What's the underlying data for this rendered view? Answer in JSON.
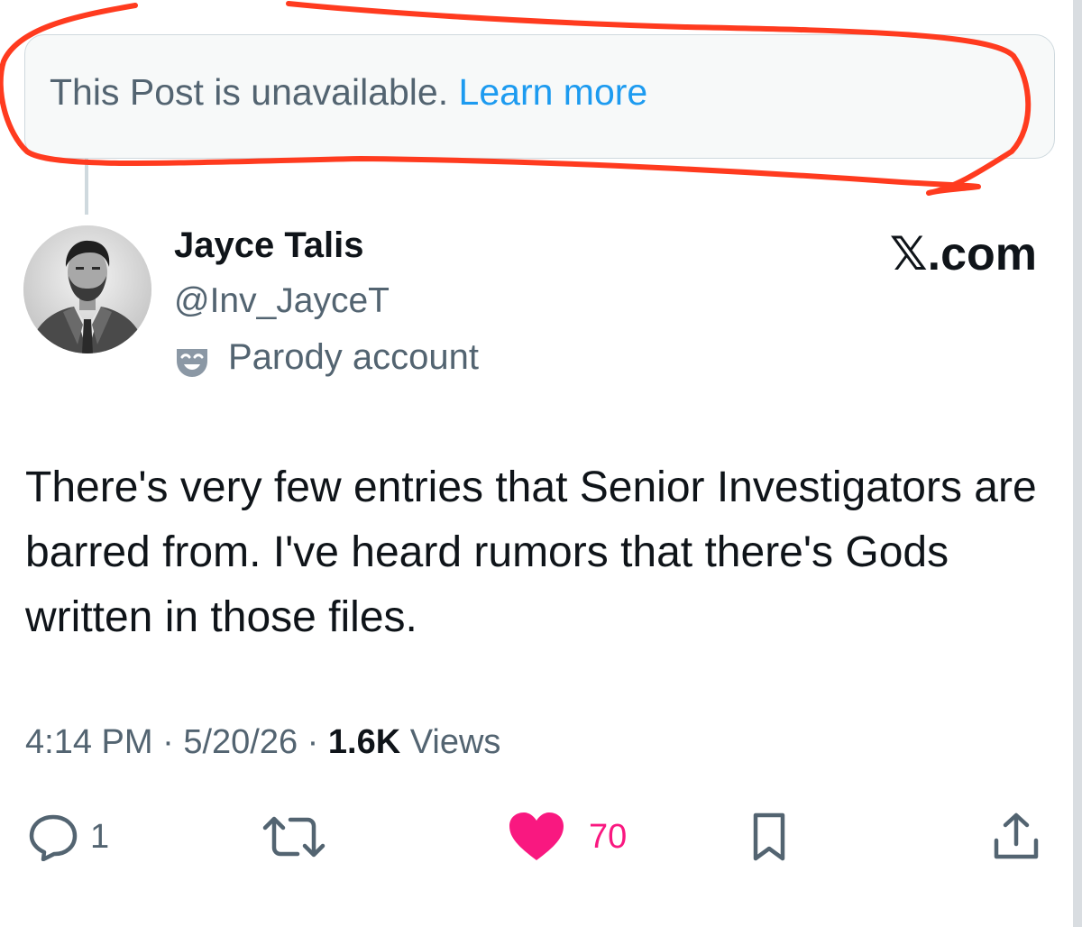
{
  "unavailable_notice": {
    "message": "This Post is unavailable.",
    "link": "Learn more"
  },
  "author": {
    "display_name": "Jayce Talis",
    "handle": "@Inv_JayceT",
    "label": "Parody account",
    "label_icon": "theater-mask-icon"
  },
  "brand": "𝕏.com",
  "post": {
    "text": "There's very few entries that Senior Investigators are barred from. I've heard rumors that there's Gods written in those files."
  },
  "meta": {
    "time": "4:14 PM",
    "separator": "·",
    "date": "5/20/26",
    "views_count": "1.6K",
    "views_label": "Views"
  },
  "actions": {
    "reply_count": "1",
    "like_count": "70",
    "liked": true
  },
  "colors": {
    "text_primary": "#0f1419",
    "text_secondary": "#536471",
    "link": "#1d9bf0",
    "like": "#f91880",
    "annotation_red": "#ff3b1f"
  }
}
